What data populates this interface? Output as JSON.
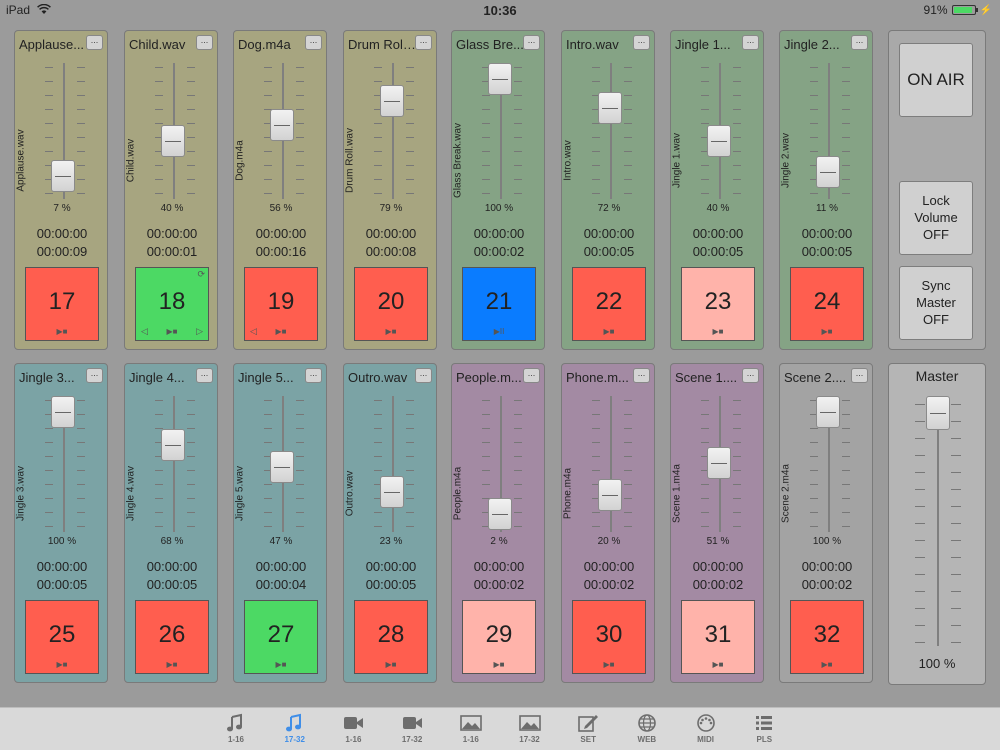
{
  "status_bar": {
    "device": "iPad",
    "time": "10:36",
    "battery": "91%"
  },
  "control_panel": {
    "on_air": "ON AIR",
    "lock_volume": [
      "Lock",
      "Volume",
      "OFF"
    ],
    "sync_master": [
      "Sync",
      "Master",
      "OFF"
    ]
  },
  "master": {
    "title": "Master",
    "volume_label": "100 %",
    "volume": 100
  },
  "players": [
    {
      "title": "Applause...",
      "file": "Applause.wav",
      "volume": 7,
      "volume_label": "7 %",
      "elapsed": "00:00:00",
      "duration": "00:00:09",
      "number": "17",
      "color": "#ff5e4f",
      "bg": "#a7a580",
      "controls": "▶■"
    },
    {
      "title": "Child.wav",
      "file": "Child.wav",
      "volume": 40,
      "volume_label": "40 %",
      "elapsed": "00:00:00",
      "duration": "00:00:01",
      "number": "18",
      "color": "#4cd964",
      "bg": "#a7a580",
      "controls": "▶■",
      "loop": "⟳",
      "prev": "◁",
      "next": "▷"
    },
    {
      "title": "Dog.m4a",
      "file": "Dog.m4a",
      "volume": 56,
      "volume_label": "56 %",
      "elapsed": "00:00:00",
      "duration": "00:00:16",
      "number": "19",
      "color": "#ff5e4f",
      "bg": "#a7a580",
      "controls": "▶■",
      "prev": "◁"
    },
    {
      "title": "Drum Roll...",
      "file": "Drum Roll.wav",
      "volume": 79,
      "volume_label": "79 %",
      "elapsed": "00:00:00",
      "duration": "00:00:08",
      "number": "20",
      "color": "#ff5e4f",
      "bg": "#a7a580",
      "controls": "▶■"
    },
    {
      "title": "Glass Bre...",
      "file": "Glass Break.wav",
      "volume": 100,
      "volume_label": "100 %",
      "elapsed": "00:00:00",
      "duration": "00:00:02",
      "number": "21",
      "color": "#0a7cff",
      "bg": "#85a385",
      "controls": "▶II"
    },
    {
      "title": "Intro.wav",
      "file": "Intro.wav",
      "volume": 72,
      "volume_label": "72 %",
      "elapsed": "00:00:00",
      "duration": "00:00:05",
      "number": "22",
      "color": "#ff5e4f",
      "bg": "#85a385",
      "controls": "▶■"
    },
    {
      "title": "Jingle 1...",
      "file": "Jingle 1.wav",
      "volume": 40,
      "volume_label": "40 %",
      "elapsed": "00:00:00",
      "duration": "00:00:05",
      "number": "23",
      "color": "#ffb3aa",
      "bg": "#85a385",
      "controls": "▶■"
    },
    {
      "title": "Jingle 2...",
      "file": "Jingle 2.wav",
      "volume": 11,
      "volume_label": "11 %",
      "elapsed": "00:00:00",
      "duration": "00:00:05",
      "number": "24",
      "color": "#ff5e4f",
      "bg": "#85a385",
      "controls": "▶■"
    },
    {
      "title": "Jingle 3...",
      "file": "Jingle 3.wav",
      "volume": 100,
      "volume_label": "100 %",
      "elapsed": "00:00:00",
      "duration": "00:00:05",
      "number": "25",
      "color": "#ff5e4f",
      "bg": "#7ba3a5",
      "controls": "▶■"
    },
    {
      "title": "Jingle 4...",
      "file": "Jingle 4.wav",
      "volume": 68,
      "volume_label": "68 %",
      "elapsed": "00:00:00",
      "duration": "00:00:05",
      "number": "26",
      "color": "#ff5e4f",
      "bg": "#7ba3a5",
      "controls": "▶■"
    },
    {
      "title": "Jingle 5...",
      "file": "Jingle 5.wav",
      "volume": 47,
      "volume_label": "47 %",
      "elapsed": "00:00:00",
      "duration": "00:00:04",
      "number": "27",
      "color": "#4cd964",
      "bg": "#7ba3a5",
      "controls": "▶■"
    },
    {
      "title": "Outro.wav",
      "file": "Outro.wav",
      "volume": 23,
      "volume_label": "23 %",
      "elapsed": "00:00:00",
      "duration": "00:00:05",
      "number": "28",
      "color": "#ff5e4f",
      "bg": "#7ba3a5",
      "controls": "▶■"
    },
    {
      "title": "People.m...",
      "file": "People.m4a",
      "volume": 2,
      "volume_label": "2 %",
      "elapsed": "00:00:00",
      "duration": "00:00:02",
      "number": "29",
      "color": "#ffb3aa",
      "bg": "#a38aa3",
      "controls": "▶■"
    },
    {
      "title": "Phone.m...",
      "file": "Phone.m4a",
      "volume": 20,
      "volume_label": "20 %",
      "elapsed": "00:00:00",
      "duration": "00:00:02",
      "number": "30",
      "color": "#ff5e4f",
      "bg": "#a38aa3",
      "controls": "▶■"
    },
    {
      "title": "Scene 1....",
      "file": "Scene 1.m4a",
      "volume": 51,
      "volume_label": "51 %",
      "elapsed": "00:00:00",
      "duration": "00:00:02",
      "number": "31",
      "color": "#ffb3aa",
      "bg": "#a38aa3",
      "controls": "▶■"
    },
    {
      "title": "Scene 2....",
      "file": "Scene 2.m4a",
      "volume": 100,
      "volume_label": "100 %",
      "elapsed": "00:00:00",
      "duration": "00:00:02",
      "number": "32",
      "color": "#ff5e4f",
      "bg": "#a3a3a3",
      "controls": "▶■"
    }
  ],
  "tabs": [
    {
      "icon": "music-note-icon",
      "label": "1-16",
      "active": false
    },
    {
      "icon": "music-note-icon",
      "label": "17-32",
      "active": true
    },
    {
      "icon": "video-camera-icon",
      "label": "1-16",
      "active": false
    },
    {
      "icon": "video-camera-icon",
      "label": "17-32",
      "active": false
    },
    {
      "icon": "image-icon",
      "label": "1-16",
      "active": false
    },
    {
      "icon": "image-icon",
      "label": "17-32",
      "active": false
    },
    {
      "icon": "pencil-edit-icon",
      "label": "SET",
      "active": false
    },
    {
      "icon": "globe-icon",
      "label": "WEB",
      "active": false
    },
    {
      "icon": "midi-connector-icon",
      "label": "MIDI",
      "active": false
    },
    {
      "icon": "list-icon",
      "label": "PLS",
      "active": false
    }
  ]
}
